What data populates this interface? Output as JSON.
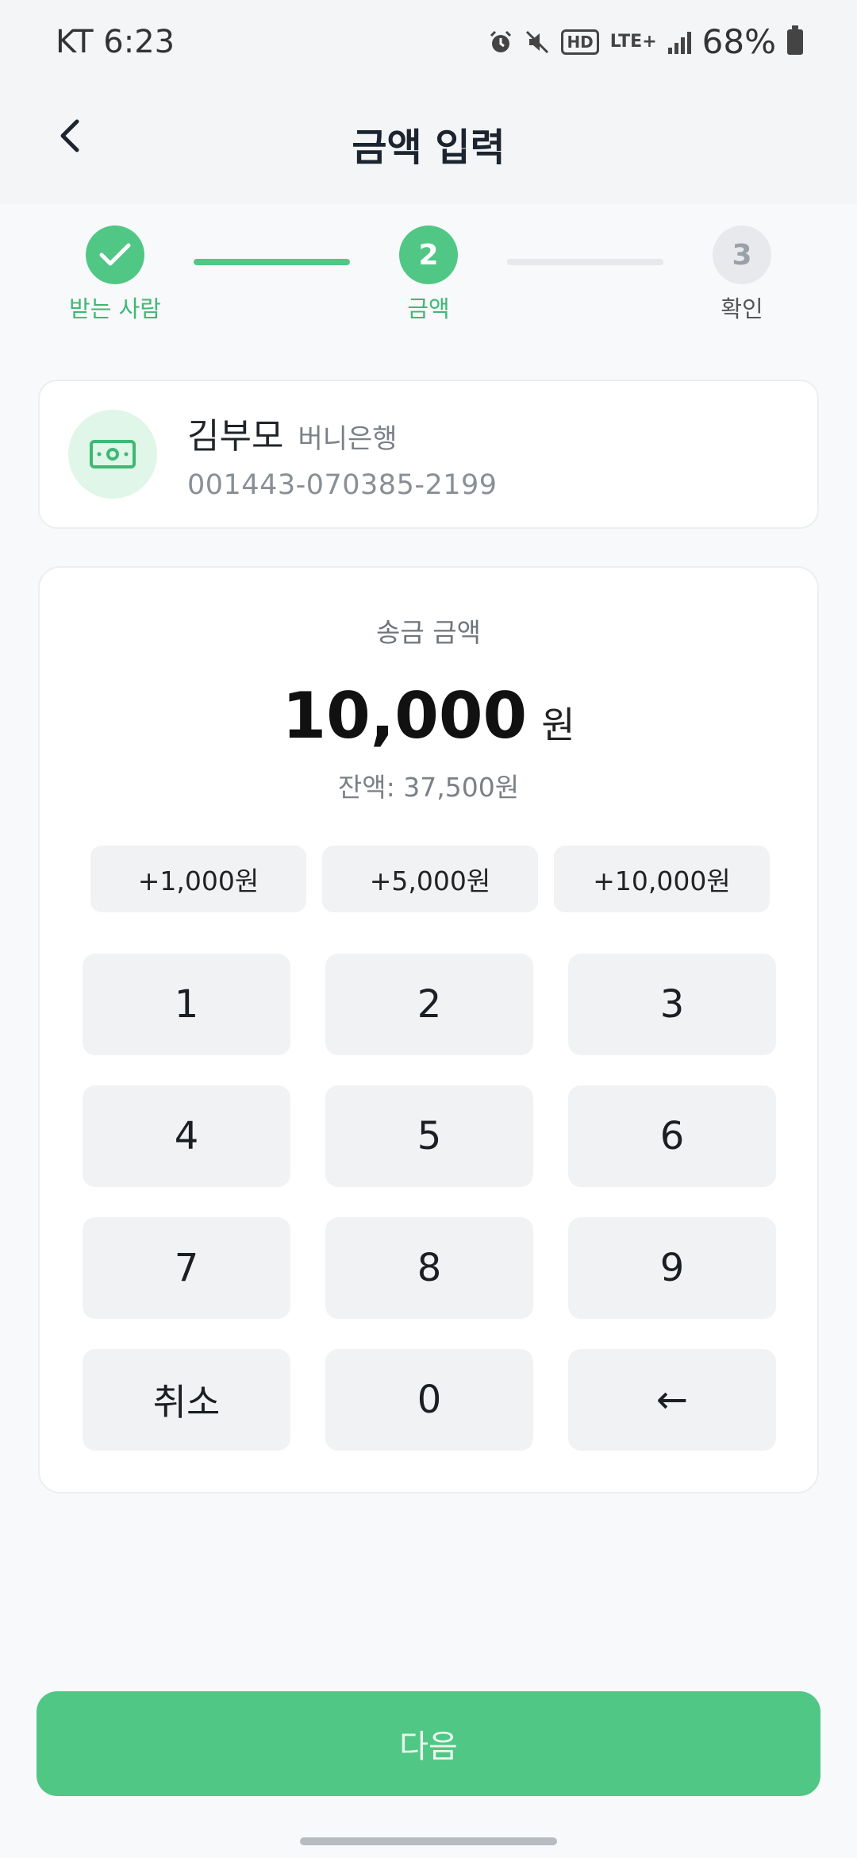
{
  "status_bar": {
    "carrier_time": "KT 6:23",
    "hd_label": "HD",
    "network": "LTE+",
    "battery_percent": "68%"
  },
  "header": {
    "title": "금액 입력"
  },
  "stepper": {
    "steps": [
      {
        "label": "받는 사람",
        "state": "done",
        "number": "1"
      },
      {
        "label": "금액",
        "state": "active",
        "number": "2"
      },
      {
        "label": "확인",
        "state": "pending",
        "number": "3"
      }
    ]
  },
  "recipient": {
    "name": "김부모",
    "bank": "버니은행",
    "account": "001443-070385-2199"
  },
  "amount": {
    "caption": "송금 금액",
    "value": "10,000",
    "unit": "원",
    "balance": "잔액: 37,500원"
  },
  "quick_add": [
    "+1,000원",
    "+5,000원",
    "+10,000원"
  ],
  "keypad": [
    "1",
    "2",
    "3",
    "4",
    "5",
    "6",
    "7",
    "8",
    "9",
    "취소",
    "0",
    "←"
  ],
  "next_button": "다음",
  "colors": {
    "accent": "#51c785",
    "accent_light": "#dff6e8",
    "key_bg": "#f1f2f4",
    "pending_gray": "#e7e9ec"
  }
}
